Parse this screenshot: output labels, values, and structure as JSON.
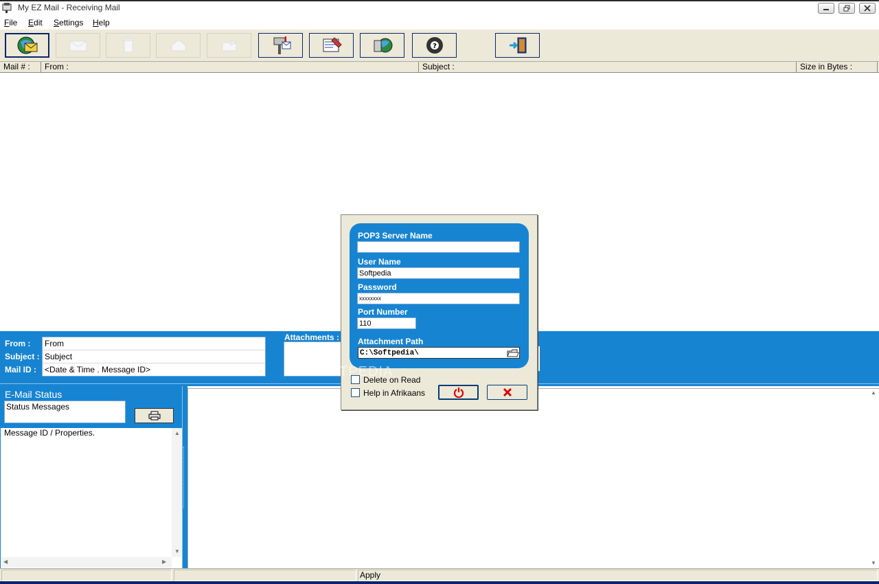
{
  "window": {
    "title": "My EZ Mail - Receiving Mail"
  },
  "menu": [
    {
      "label_u": "F",
      "label_rest": "ile"
    },
    {
      "label_u": "E",
      "label_rest": "dit"
    },
    {
      "label_u": "S",
      "label_rest": "ettings"
    },
    {
      "label_u": "H",
      "label_rest": "elp"
    }
  ],
  "toolbar": {
    "buttons": [
      {
        "name": "receive-mail",
        "icon": "globe-mail-icon",
        "enabled": true
      },
      {
        "name": "compose",
        "icon": "envelope-icon",
        "enabled": false
      },
      {
        "name": "delete",
        "icon": "trash-icon",
        "enabled": false
      },
      {
        "name": "reply",
        "icon": "reply-icon",
        "enabled": false
      },
      {
        "name": "forward",
        "icon": "forward-icon",
        "enabled": false
      },
      {
        "name": "mailbox",
        "icon": "mailbox-icon",
        "enabled": true
      },
      {
        "name": "address-book",
        "icon": "address-book-icon",
        "enabled": true
      },
      {
        "name": "send",
        "icon": "send-globe-icon",
        "enabled": true
      },
      {
        "name": "help",
        "icon": "help-ball-icon",
        "enabled": true
      },
      {
        "name": "exit",
        "icon": "exit-door-icon",
        "enabled": true
      }
    ]
  },
  "list": {
    "columns": [
      "Mail # :",
      "From :",
      "Subject :",
      "Size in Bytes :"
    ]
  },
  "info": {
    "from_label": "From :",
    "subject_label": "Subject :",
    "mailid_label": "Mail ID :",
    "from_value": "From",
    "subject_value": "Subject",
    "mailid_value": "<Date & Time . Message ID>",
    "attachments_label": "Attachments :"
  },
  "status": {
    "title": "E-Mail Status",
    "messages": "Status Messages",
    "properties": "Message ID / Properties."
  },
  "statusbar": {
    "apply": "Apply"
  },
  "dialog": {
    "pop3_label": "POP3 Server Name",
    "pop3_value": "",
    "user_label": "User Name",
    "user_value": "Softpedia",
    "password_label": "Password",
    "password_value": "xxxxxxxx",
    "port_label": "Port Number",
    "port_value": "110",
    "attach_label": "Attachment Path",
    "attach_value": "C:\\Softpedia\\",
    "delete_on_read": "Delete on Read",
    "help_afrikaans": "Help in Afrikaans"
  },
  "watermark": "SOFTPEDIA",
  "colors": {
    "accent_blue": "#1784d2",
    "toolbar_bg": "#ece9d8",
    "border_navy": "#0a246a",
    "cancel_red": "#e00000"
  }
}
